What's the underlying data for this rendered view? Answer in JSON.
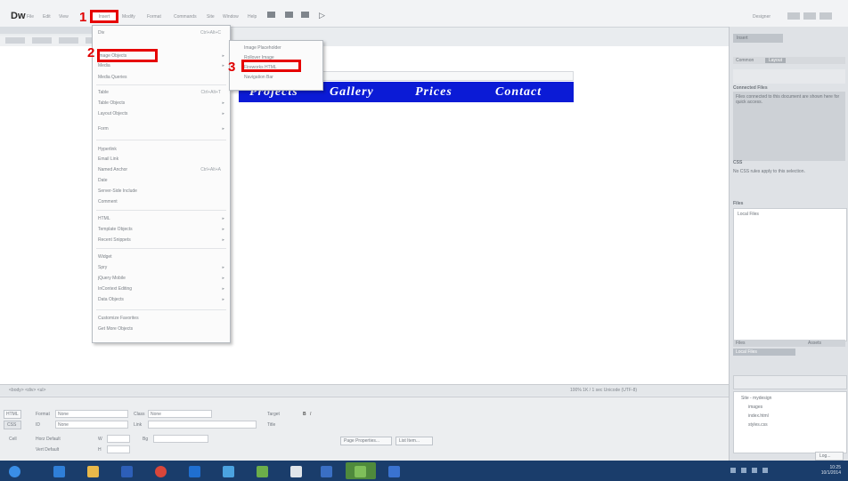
{
  "app": {
    "logo": "Dw"
  },
  "menubar": {
    "items": [
      "File",
      "Edit",
      "View",
      "Insert",
      "Modify",
      "Format",
      "Commands",
      "Site",
      "Window",
      "Help"
    ],
    "search_placeholder": "Search",
    "layout_label": "Designer"
  },
  "document": {
    "tabs": [
      "Code",
      "Split",
      "Design",
      "Live"
    ],
    "nav_links": [
      "Projects",
      "Gallery",
      "Prices",
      "Contact"
    ],
    "nav_color": "#0b1bd6"
  },
  "insert_menu": {
    "items": [
      {
        "label": "Div",
        "shortcut": "Ctrl+Alt+C"
      },
      {
        "label": "Image Objects",
        "arrow": true
      },
      {
        "label": "Media",
        "arrow": true
      },
      {
        "label": "Media Queries"
      },
      {
        "label": "Table",
        "shortcut": "Ctrl+Alt+T"
      },
      {
        "label": "Table Objects",
        "arrow": true
      },
      {
        "label": "Layout Objects",
        "arrow": true
      },
      {
        "label": "Form",
        "arrow": true
      },
      {
        "label": "Hyperlink"
      },
      {
        "label": "Email Link"
      },
      {
        "label": "Named Anchor",
        "shortcut": "Ctrl+Alt+A"
      },
      {
        "label": "Date"
      },
      {
        "label": "Server-Side Include"
      },
      {
        "label": "Comment"
      },
      {
        "label": "HTML",
        "arrow": true
      },
      {
        "label": "Template Objects",
        "arrow": true
      },
      {
        "label": "Recent Snippets",
        "arrow": true
      },
      {
        "label": "Widget"
      },
      {
        "label": "Spry",
        "arrow": true
      },
      {
        "label": "jQuery Mobile",
        "arrow": true
      },
      {
        "label": "InContext Editing",
        "arrow": true
      },
      {
        "label": "Data Objects",
        "arrow": true
      },
      {
        "label": "Customize Favorites"
      },
      {
        "label": "Get More Objects"
      }
    ]
  },
  "image_submenu": {
    "items": [
      "Image Placeholder",
      "Rollover Image",
      "Fireworks HTML",
      "Navigation Bar"
    ]
  },
  "annotations": {
    "step1": "1",
    "step2": "2",
    "step3": "3",
    "color": "#e00000"
  },
  "right_panel": {
    "header": "Insert",
    "tabs": [
      "Common",
      "Layout"
    ],
    "section1_title": "Connected Files",
    "section1_text": "Files connected to this document are shown here for quick access.",
    "section2_title": "CSS",
    "section2_text": "No CSS rules apply to this selection.",
    "section3_title": "Files",
    "section3_item": "Local Files",
    "files_tab": "Files",
    "assets_tab": "Assets",
    "site_label": "Local Files",
    "tree_items": [
      "Site - mydesign",
      "images",
      "index.html",
      "styles.css"
    ],
    "log_button": "Log..."
  },
  "statusbar": {
    "tag": "<body> <div> <ul>",
    "info": "100% 1K / 1 sec Unicode (UTF-8)"
  },
  "properties": {
    "html_button": "HTML",
    "css_button": "CSS",
    "format_label": "Format",
    "format_value": "None",
    "class_label": "Class",
    "class_value": "None",
    "id_label": "ID",
    "id_value": "None",
    "link_label": "Link",
    "title_label": "Title",
    "target_label": "Target",
    "cell_label": "Cell",
    "page_properties_button": "Page Properties...",
    "list_item_button": "List Item...",
    "horz_label": "Horz Default",
    "vert_label": "Vert Default",
    "w_label": "W",
    "h_label": "H",
    "bg_label": "Bg"
  },
  "taskbar": {
    "apps": [
      "Start",
      "Internet Explorer",
      "File Explorer",
      "Media Player",
      "Chrome",
      "Photoshop",
      "Illustrator",
      "Dreamweaver",
      "Firefox",
      "Folder",
      "Flash",
      "Word"
    ],
    "time": "10:25",
    "date": "10/1/2014"
  }
}
